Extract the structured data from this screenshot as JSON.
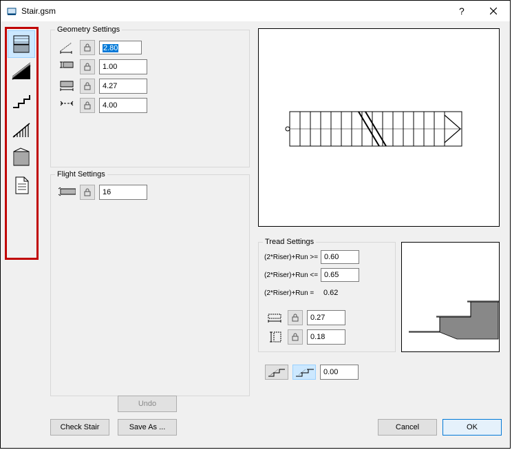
{
  "window": {
    "title": "Stair.gsm"
  },
  "groups": {
    "geometry": "Geometry Settings",
    "flight": "Flight Settings",
    "tread": "Tread Settings"
  },
  "geometry": {
    "len": "2.80",
    "width": "1.00",
    "run_total": "4.27",
    "rise_total": "4.00"
  },
  "flight": {
    "steps": "16"
  },
  "tread": {
    "formula_ge_label": "(2*Riser)+Run >=",
    "formula_ge": "0.60",
    "formula_le_label": "(2*Riser)+Run <=",
    "formula_le": "0.65",
    "formula_eq_label": "(2*Riser)+Run =",
    "formula_eq": "0.62",
    "run": "0.27",
    "riser": "0.18",
    "nosing": "0.00"
  },
  "buttons": {
    "undo": "Undo",
    "check": "Check Stair",
    "saveas": "Save As ...",
    "cancel": "Cancel",
    "ok": "OK"
  }
}
